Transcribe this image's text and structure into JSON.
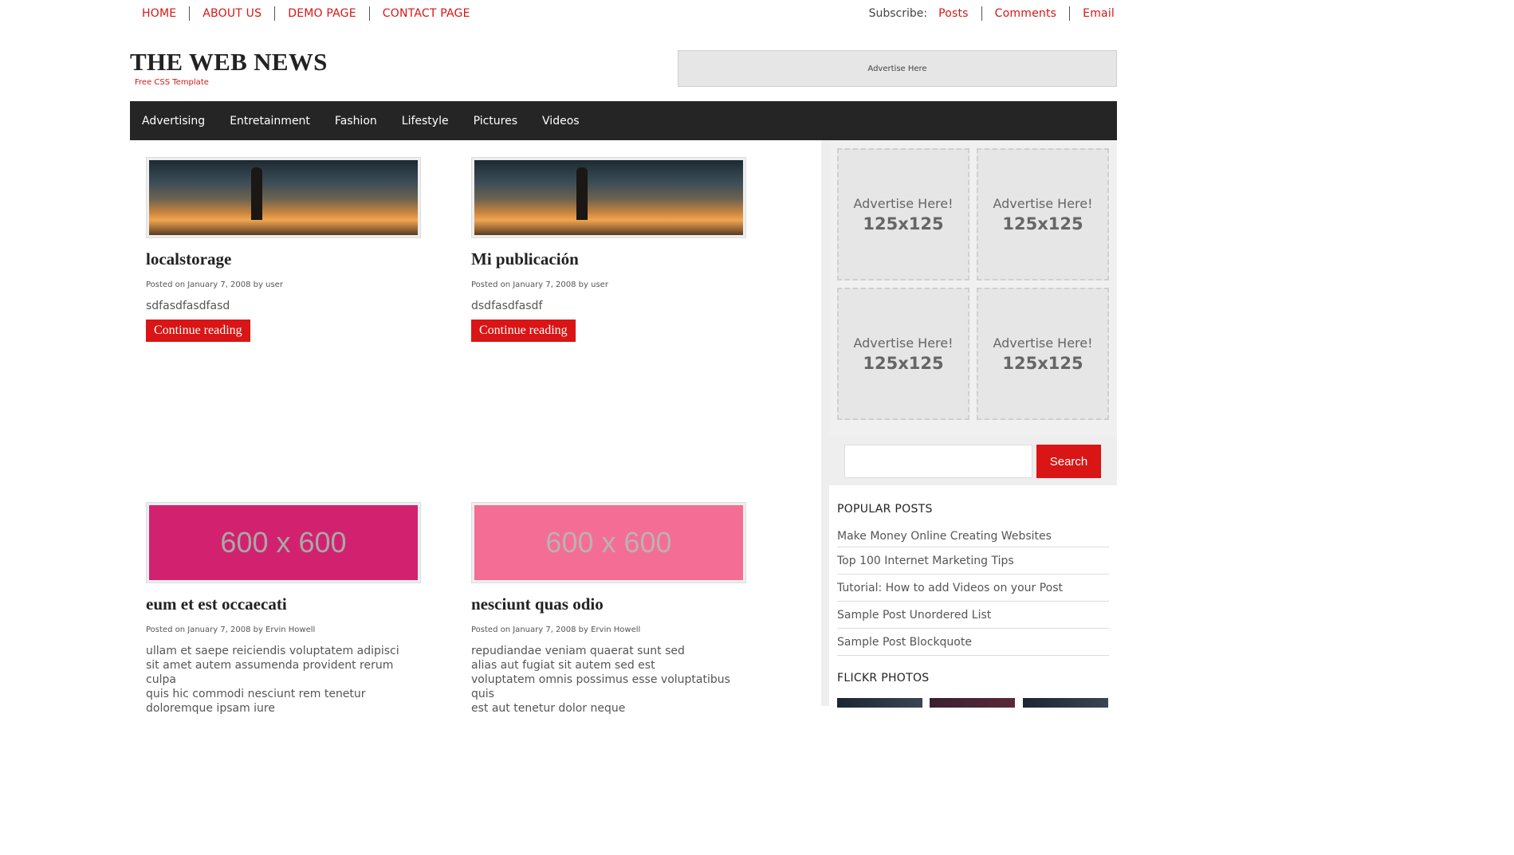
{
  "top_nav": {
    "links": [
      "HOME",
      "ABOUT US",
      "DEMO PAGE",
      "CONTACT PAGE"
    ],
    "subscribe_label": "Subscribe:",
    "subscribe_links": [
      "Posts",
      "Comments",
      "Email"
    ]
  },
  "header": {
    "title": "THE WEB NEWS",
    "tagline": "Free CSS Template",
    "ad_text": "Advertise Here"
  },
  "main_menu": [
    "Advertising",
    "Entretainment",
    "Fashion",
    "Lifestyle",
    "Pictures",
    "Videos"
  ],
  "posts": [
    {
      "title": "localstorage",
      "meta": "Posted on January 7, 2008 by user",
      "excerpt": "sdfasdfasdfasd",
      "button": "Continue reading"
    },
    {
      "title": "Mi publicación",
      "meta": "Posted on January 7, 2008 by user",
      "excerpt": "dsdfasdfasdf",
      "button": "Continue reading"
    },
    {
      "title": "eum et est occaecati",
      "meta": "Posted on January 7, 2008 by Ervin Howell",
      "thumb_text": "600 x 600",
      "thumb_bg": "#d2226f",
      "thumb_fg": "#a8a8a8",
      "excerpt_lines": [
        "ullam et saepe reiciendis voluptatem adipisci",
        "sit amet autem assumenda provident rerum culpa",
        "quis hic commodi nesciunt rem tenetur",
        "doloremque ipsam iure"
      ]
    },
    {
      "title": "nesciunt quas odio",
      "meta": "Posted on January 7, 2008 by Ervin Howell",
      "thumb_text": "600 x 600",
      "thumb_bg": "#f46d95",
      "thumb_fg": "#bdb0b4",
      "excerpt_lines": [
        "repudiandae veniam quaerat sunt sed",
        "alias aut fugiat sit autem sed est",
        "voluptatem omnis possimus esse voluptatibus quis",
        "est aut tenetur dolor neque"
      ]
    }
  ],
  "sidebar": {
    "ads": [
      {
        "line1": "Advertise Here!",
        "line2": "125x125"
      },
      {
        "line1": "Advertise Here!",
        "line2": "125x125"
      },
      {
        "line1": "Advertise Here!",
        "line2": "125x125"
      },
      {
        "line1": "Advertise Here!",
        "line2": "125x125"
      }
    ],
    "search": {
      "placeholder": "",
      "button": "Search"
    },
    "popular_posts_title": "POPULAR POSTS",
    "popular_posts": [
      "Make Money Online Creating Websites",
      "Top 100 Internet Marketing Tips",
      "Tutorial: How to add Videos on your Post",
      "Sample Post Unordered List",
      "Sample Post Blockquote"
    ],
    "flickr_title": "FLICKR PHOTOS"
  },
  "colors": {
    "accent": "#d91515",
    "menu_bg": "#252525"
  }
}
